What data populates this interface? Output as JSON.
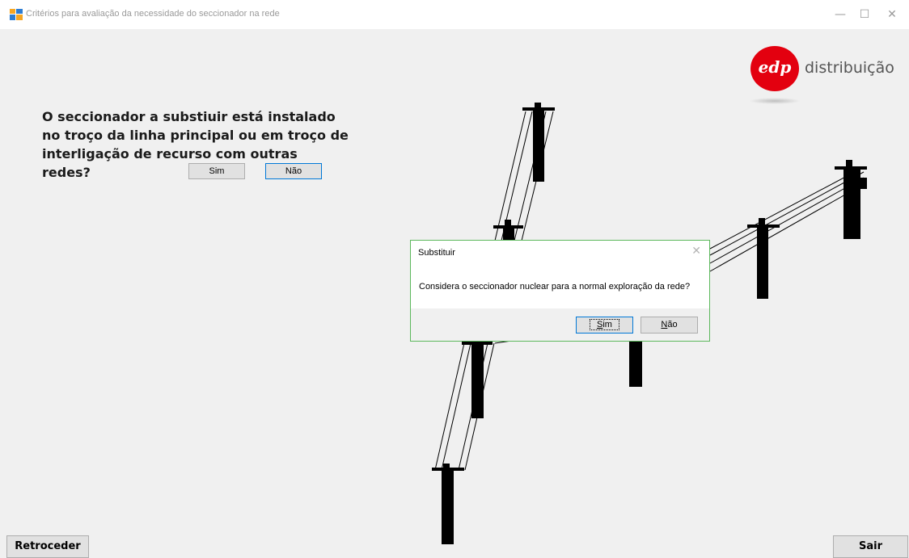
{
  "window": {
    "title": "Critérios para avaliação da necessidade do seccionador na rede",
    "minimize": "—",
    "maximize": "☐",
    "close": "✕"
  },
  "logo": {
    "mark": "edp",
    "text": "distribuição",
    "brand_color": "#e3000f"
  },
  "question": {
    "text": "O seccionador a substiuir está instalado no troço da linha principal ou em troço de interligação de recurso com outras redes?",
    "yes_label": "Sim",
    "no_label": "Não"
  },
  "dialog": {
    "title": "Substituir",
    "message": "Considera o seccionador nuclear para a normal exploração da rede?",
    "yes_accel": "S",
    "yes_rest": "im",
    "no_accel": "N",
    "no_rest": "ão",
    "close": "✕"
  },
  "footer": {
    "back_label": "Retroceder",
    "exit_label": "Sair"
  },
  "icons": {
    "app": "app-window-icon",
    "dialog_close": "close-icon"
  }
}
